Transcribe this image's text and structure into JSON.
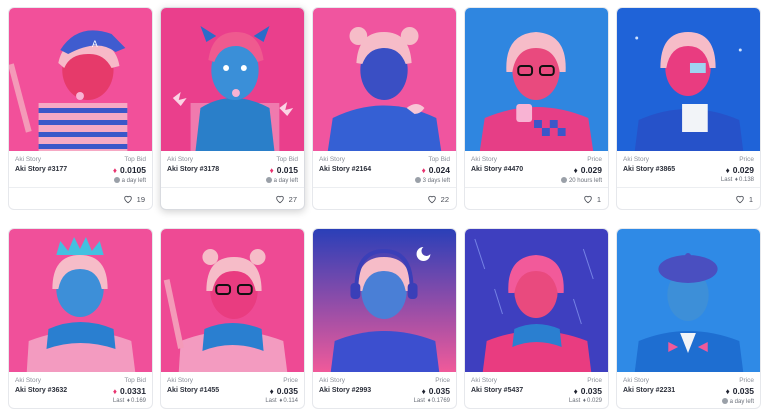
{
  "cards": [
    {
      "collection": "Aki Story",
      "name": "Aki Story #3177",
      "price_label": "Top Bid",
      "price": "0.0105",
      "price_color": "pink",
      "sub_type": "time",
      "sub": "a day left",
      "likes": "19",
      "bg": "#f2509a"
    },
    {
      "collection": "Aki Story",
      "name": "Aki Story #3178",
      "price_label": "Top Bid",
      "price": "0.015",
      "price_color": "pink",
      "sub_type": "time",
      "sub": "a day left",
      "likes": "27",
      "bg": "#ea3f8c"
    },
    {
      "collection": "Aki Story",
      "name": "Aki Story #2164",
      "price_label": "Top Bid",
      "price": "0.024",
      "price_color": "pink",
      "sub_type": "time",
      "sub": "3 days left",
      "likes": "22",
      "bg": "#f0559f"
    },
    {
      "collection": "Aki Story",
      "name": "Aki Story #4470",
      "price_label": "Price",
      "price": "0.029",
      "price_color": "dark",
      "sub_type": "time",
      "sub": "20 hours left",
      "likes": "1",
      "bg": "#2f86e0"
    },
    {
      "collection": "Aki Story",
      "name": "Aki Story #3865",
      "price_label": "Price",
      "price": "0.029",
      "price_color": "dark",
      "sub_type": "last",
      "sub_prefix": "Last",
      "sub": "0.138",
      "likes": "1",
      "bg": "#1f63d8"
    },
    {
      "collection": "Aki Story",
      "name": "Aki Story #3632",
      "price_label": "Top Bid",
      "price": "0.0331",
      "price_color": "pink",
      "sub_type": "last",
      "sub_prefix": "Last",
      "sub": "0.169",
      "likes": "",
      "bg": "#f0509a"
    },
    {
      "collection": "Aki Story",
      "name": "Aki Story #1455",
      "price_label": "Price",
      "price": "0.035",
      "price_color": "dark",
      "sub_type": "last",
      "sub_prefix": "Last",
      "sub": "0.114",
      "likes": "",
      "bg": "#ee4a94"
    },
    {
      "collection": "Aki Story",
      "name": "Aki Story #2993",
      "price_label": "Price",
      "price": "0.035",
      "price_color": "dark",
      "sub_type": "last",
      "sub_prefix": "Last",
      "sub": "0.1769",
      "likes": "",
      "bg": "#2a3fb8"
    },
    {
      "collection": "Aki Story",
      "name": "Aki Story #5437",
      "price_label": "Price",
      "price": "0.035",
      "price_color": "dark",
      "sub_type": "last",
      "sub_prefix": "Last",
      "sub": "0.029",
      "likes": "",
      "bg": "#3e3fbf"
    },
    {
      "collection": "Aki Story",
      "name": "Aki Story #2231",
      "price_label": "Price",
      "price": "0.035",
      "price_color": "dark",
      "sub_type": "time",
      "sub": "a day left",
      "likes": "",
      "bg": "#2f8ae6"
    }
  ],
  "colors": {
    "pink_accent": "#e8336f",
    "eth_dark": "#1f2330",
    "heart_stroke": "#4b4f58"
  },
  "icons": {
    "heart": "heart-icon",
    "clock": "clock-icon",
    "ethereum": "eth-icon"
  }
}
